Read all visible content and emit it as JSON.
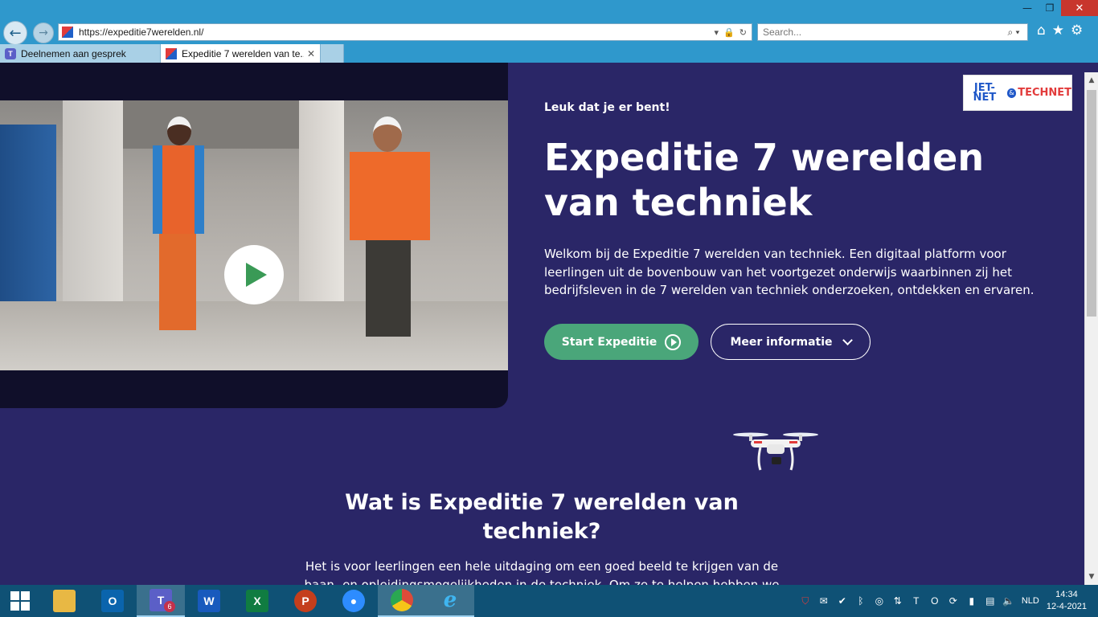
{
  "browser": {
    "address_url": "https://expeditie7werelden.nl/",
    "search_placeholder": "Search...",
    "tabs": [
      {
        "label": "Deelnemen aan gesprek",
        "active": false
      },
      {
        "label": "Expeditie 7 werelden van te...",
        "active": true
      }
    ],
    "window_controls": {
      "minimize": "—",
      "restore": "❐",
      "close": "✕"
    },
    "toolbar_icons": [
      "home-icon",
      "star-icon",
      "gear-icon"
    ]
  },
  "hero": {
    "kicker": "Leuk dat je er bent!",
    "title": "Expeditie 7 werelden van techniek",
    "description": "Welkom bij de Expeditie 7 werelden van techniek. Een digitaal platform voor leerlingen uit de bovenbouw van het voortgezet onderwijs waarbinnen zij het bedrijfsleven in de 7 werelden van techniek onderzoeken, ontdekken en ervaren.",
    "start_label": "Start Expeditie",
    "more_label": "Meer informatie"
  },
  "logo": {
    "left": "JET-NET",
    "right": "TECHNET",
    "amp": "&"
  },
  "section": {
    "title": "Wat is Expeditie 7 werelden van techniek?",
    "text": "Het is voor leerlingen een hele uitdaging om een goed beeld te krijgen van de baan- en opleidingsmogelijkheden in de techniek. Om ze te helpen hebben we de"
  },
  "taskbar": {
    "apps": [
      {
        "name": "file-explorer",
        "label": "",
        "color": "#e8b844"
      },
      {
        "name": "outlook",
        "label": "O",
        "color": "#0a64ad"
      },
      {
        "name": "teams",
        "label": "T",
        "color": "#5b5fc7",
        "badge": "6"
      },
      {
        "name": "word",
        "label": "W",
        "color": "#185abd"
      },
      {
        "name": "excel",
        "label": "X",
        "color": "#107c41"
      },
      {
        "name": "powerpoint",
        "label": "P",
        "color": "#c43e1c"
      },
      {
        "name": "zoom",
        "label": "●",
        "color": "#2d8cff"
      },
      {
        "name": "chrome",
        "label": "",
        "color": "#dd4b39"
      },
      {
        "name": "internet-explorer",
        "label": "e",
        "color": "#1ea0e8"
      }
    ],
    "language": "NLD",
    "time": "14:34",
    "date": "12-4-2021"
  },
  "colors": {
    "page_bg": "#2a2667",
    "video_panel_bg": "#100f2a",
    "start_button": "#4aa67a",
    "chrome_bg": "#2f98cc",
    "taskbar_bg": "#0f5175"
  }
}
